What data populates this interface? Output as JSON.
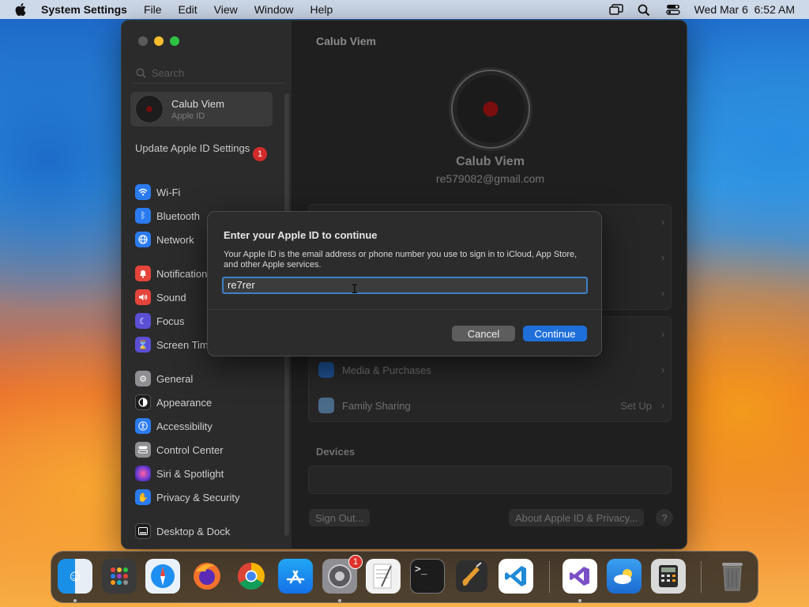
{
  "menubar": {
    "app_name": "System Settings",
    "items": [
      "File",
      "Edit",
      "View",
      "Window",
      "Help"
    ],
    "datetime": "Wed Mar 6  6:52 AM"
  },
  "sidebar": {
    "search_placeholder": "Search",
    "account_name": "Calub Viem",
    "account_sub": "Apple ID",
    "update_label": "Update Apple ID Settings",
    "update_badge": "1",
    "items": [
      {
        "label": "Wi-Fi",
        "icon": "wifi-icon",
        "color": "#2b7bf0"
      },
      {
        "label": "Bluetooth",
        "icon": "bluetooth-icon",
        "color": "#2b7bf0"
      },
      {
        "label": "Network",
        "icon": "globe-icon",
        "color": "#2b7bf0"
      },
      {
        "label": "Notifications",
        "icon": "bell-icon",
        "color": "#e5443a"
      },
      {
        "label": "Sound",
        "icon": "speaker-icon",
        "color": "#e5443a"
      },
      {
        "label": "Focus",
        "icon": "moon-icon",
        "color": "#5b4fd6"
      },
      {
        "label": "Screen Time",
        "icon": "hourglass-icon",
        "color": "#5b4fd6"
      },
      {
        "label": "General",
        "icon": "gear-icon",
        "color": "#8e8e93"
      },
      {
        "label": "Appearance",
        "icon": "appearance-icon",
        "color": "#1c1c1c"
      },
      {
        "label": "Accessibility",
        "icon": "accessibility-icon",
        "color": "#2b7bf0"
      },
      {
        "label": "Control Center",
        "icon": "control-center-icon",
        "color": "#8e8e93"
      },
      {
        "label": "Siri & Spotlight",
        "icon": "siri-icon",
        "color": "#a040c0"
      },
      {
        "label": "Privacy & Security",
        "icon": "hand-icon",
        "color": "#2b7bf0"
      },
      {
        "label": "Desktop & Dock",
        "icon": "dock-icon",
        "color": "#1c1c1c"
      }
    ]
  },
  "main": {
    "title": "Calub Viem",
    "profile_name": "Calub Viem",
    "profile_email": "re579082@gmail.com",
    "rows": {
      "media": "Media & Purchases",
      "family": "Family Sharing",
      "family_value": "Set Up"
    },
    "devices_label": "Devices",
    "sign_out": "Sign Out...",
    "about": "About Apple ID & Privacy...",
    "help": "?"
  },
  "dialog": {
    "title": "Enter your Apple ID to continue",
    "description": "Your Apple ID is the email address or phone number you use to sign in to iCloud, App Store, and other Apple services.",
    "field_value": "re7rer",
    "cancel": "Cancel",
    "continue": "Continue",
    "accent": "#1e6fd9"
  },
  "dock": {
    "settings_badge": "1"
  }
}
